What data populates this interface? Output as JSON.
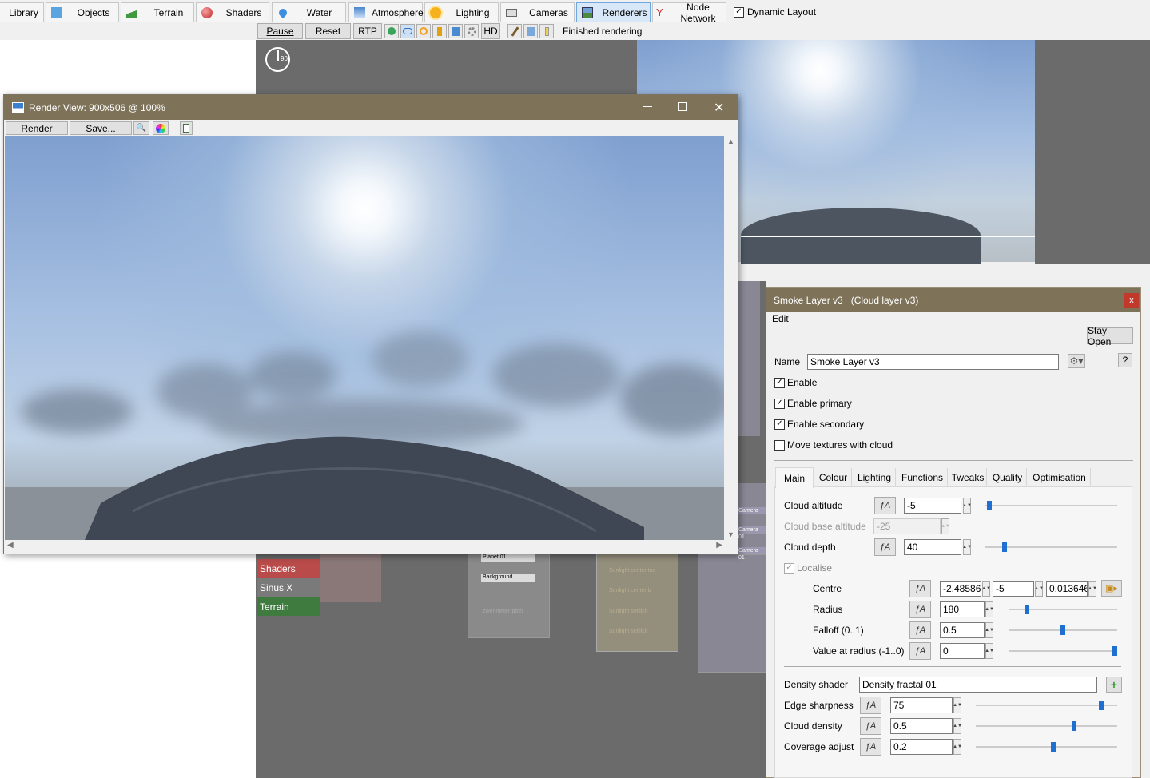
{
  "toolbar": {
    "tabs": [
      {
        "label": "Library",
        "icon": "library-icon"
      },
      {
        "label": "Objects",
        "icon": "cube-icon"
      },
      {
        "label": "Terrain",
        "icon": "terrain-icon"
      },
      {
        "label": "Shaders",
        "icon": "sphere-icon"
      },
      {
        "label": "Water",
        "icon": "water-drop-icon"
      },
      {
        "label": "Atmosphere",
        "icon": "atmosphere-icon"
      },
      {
        "label": "Lighting",
        "icon": "sun-icon"
      },
      {
        "label": "Cameras",
        "icon": "camera-icon"
      },
      {
        "label": "Renderers",
        "icon": "renderer-icon"
      },
      {
        "label": "Node Network",
        "icon": "node-network-icon"
      }
    ],
    "dynamic_layout": "Dynamic Layout",
    "pause": "Pause",
    "reset": "Reset",
    "rtp": "RTP",
    "hd": "HD",
    "status": "Finished rendering"
  },
  "compass": {
    "value": "90"
  },
  "render_view": {
    "title": "Render View: 900x506 @ 100%",
    "render_btn": "Render",
    "save_btn": "Save..."
  },
  "nodes": {
    "shaders": "Shaders",
    "sinus": "Sinus X",
    "terrain": "Terrain",
    "planet": "Planet 01",
    "background": "Background",
    "zwei": "zwei-meter-pfah",
    "sun1": "Sunlight center tod",
    "sun2": "Sunlight center b",
    "sun3": "Sunlight seitlich",
    "sun4": "Sunlight seitlich",
    "cam1": "Camera",
    "cam2": "Camera 01",
    "cam3": "Camera 01"
  },
  "panel": {
    "title": "Smoke Layer v3   (Cloud layer v3)",
    "close": "x",
    "menu": "Edit",
    "stay_open": "Stay Open",
    "name_label": "Name",
    "name_value": "Smoke Layer v3",
    "help": "?",
    "enable": "Enable",
    "enable_primary": "Enable primary",
    "enable_secondary": "Enable secondary",
    "move_textures": "Move textures with cloud",
    "tabs": [
      "Main",
      "Colour",
      "Lighting",
      "Functions",
      "Tweaks",
      "Quality",
      "Optimisation"
    ],
    "cloud_altitude": {
      "label": "Cloud altitude",
      "value": "-5",
      "slider": 0.02
    },
    "cloud_base_altitude": {
      "label": "Cloud base altitude",
      "value": "-25"
    },
    "cloud_depth": {
      "label": "Cloud depth",
      "value": "40",
      "slider": 0.14
    },
    "localise": "Localise",
    "centre": {
      "label": "Centre",
      "x": "-2.48586",
      "y": "-5",
      "z": "0.013646"
    },
    "radius": {
      "label": "Radius",
      "value": "180",
      "slider": 0.15
    },
    "falloff": {
      "label": "Falloff (0..1)",
      "value": "0.5",
      "slider": 0.5
    },
    "value_at_radius": {
      "label": "Value at radius (-1..0)",
      "value": "0",
      "slider": 1.0
    },
    "density_shader": {
      "label": "Density shader",
      "value": "Density fractal 01"
    },
    "edge_sharpness": {
      "label": "Edge sharpness",
      "value": "75",
      "slider": 0.9
    },
    "cloud_density": {
      "label": "Cloud density",
      "value": "0.5",
      "slider": 0.7
    },
    "coverage_adjust": {
      "label": "Coverage adjust",
      "value": "0.2",
      "slider": 0.55
    }
  }
}
